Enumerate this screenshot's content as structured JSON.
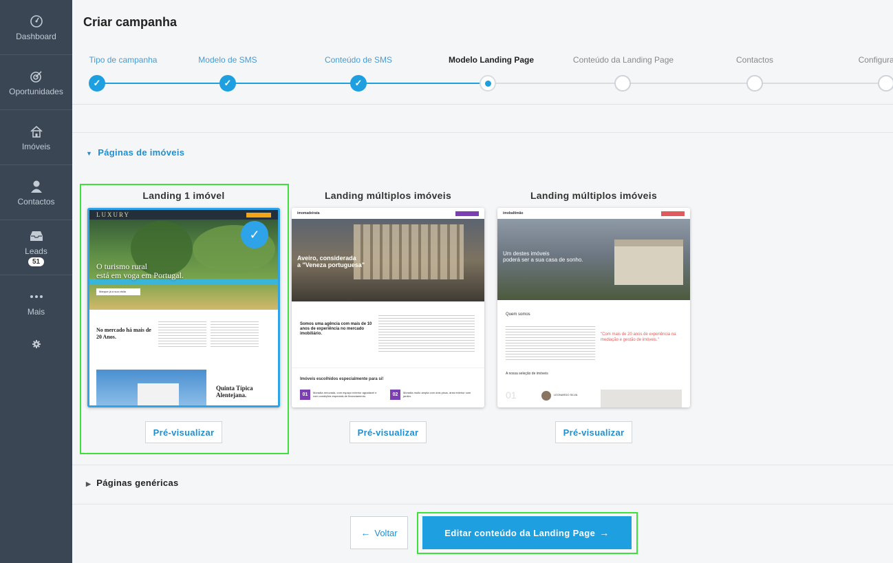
{
  "sidebar": {
    "items": [
      {
        "label": "Dashboard",
        "icon": "speedometer-icon"
      },
      {
        "label": "Oportunidades",
        "icon": "target-icon"
      },
      {
        "label": "Imóveis",
        "icon": "house-icon"
      },
      {
        "label": "Contactos",
        "icon": "person-icon"
      },
      {
        "label": "Leads",
        "icon": "inbox-icon",
        "badge": "51"
      },
      {
        "label": "Mais",
        "icon": "more-dots-icon"
      }
    ],
    "settings_icon": "gear-icon"
  },
  "header": {
    "title": "Criar campanha"
  },
  "steps": [
    {
      "label": "Tipo de campanha",
      "state": "done"
    },
    {
      "label": "Modelo de SMS",
      "state": "done"
    },
    {
      "label": "Conteúdo de SMS",
      "state": "done"
    },
    {
      "label": "Modelo Landing Page",
      "state": "current"
    },
    {
      "label": "Conteúdo da Landing Page",
      "state": "pending"
    },
    {
      "label": "Contactos",
      "state": "pending"
    },
    {
      "label": "Configuraçõ",
      "state": "pending"
    }
  ],
  "section_property": {
    "title": "Páginas de imóveis",
    "cards": [
      {
        "title": "Landing 1 imóvel",
        "selected": true,
        "preview_label": "Pré-visualizar",
        "thumb": {
          "brand": "LUXURY",
          "hero_line1": "O turismo rural",
          "hero_line2": "está em voga em Portugal.",
          "hero_button": "Marque já a sua visita",
          "section_head": "No mercado há mais de 20 Anos.",
          "feature_title": "Quinta Típica Alentejana."
        }
      },
      {
        "title": "Landing múltiplos imóveis",
        "selected": false,
        "preview_label": "Pré-visualizar",
        "thumb": {
          "brand": "imomadeirata",
          "hero_line1": "Aveiro, considerada",
          "hero_line2": "a \"Veneza portuguesa\"",
          "section_head": "Somos uma agência com mais de 10 anos de experiência no mercado imobiliário.",
          "list_title": "Imóveis escolhidos especialmente para si!",
          "item1_num": "01",
          "item1_text": "Moradia renovada, com espaço exterior agradável e com condições especiais de financiamento.",
          "item2_num": "02",
          "item2_text": "Moradia muito ampla com dois pisos, área exterior com jardim."
        }
      },
      {
        "title": "Landing múltiplos imóveis",
        "selected": false,
        "preview_label": "Pré-visualizar",
        "thumb": {
          "brand": "imobaltimão",
          "hero_line1": "Um destes imóveis",
          "hero_line2": "poderá ser a sua casa de sonho.",
          "section_head": "Quem somos",
          "quote": "\"Com mais de 20 anos de experiência na mediação e gestão de imóveis.\"",
          "list_title": "A nossa seleção de imóveis",
          "item1_num": "01",
          "agent": "LEONARDO SILVA"
        }
      }
    ]
  },
  "section_generic": {
    "title": "Páginas genéricas"
  },
  "footer": {
    "back_label": "Voltar",
    "next_label": "Editar conteúdo da Landing Page"
  },
  "colors": {
    "sidebar_bg": "#3a4654",
    "accent": "#1e9fe0",
    "highlight": "#3ce13c"
  }
}
